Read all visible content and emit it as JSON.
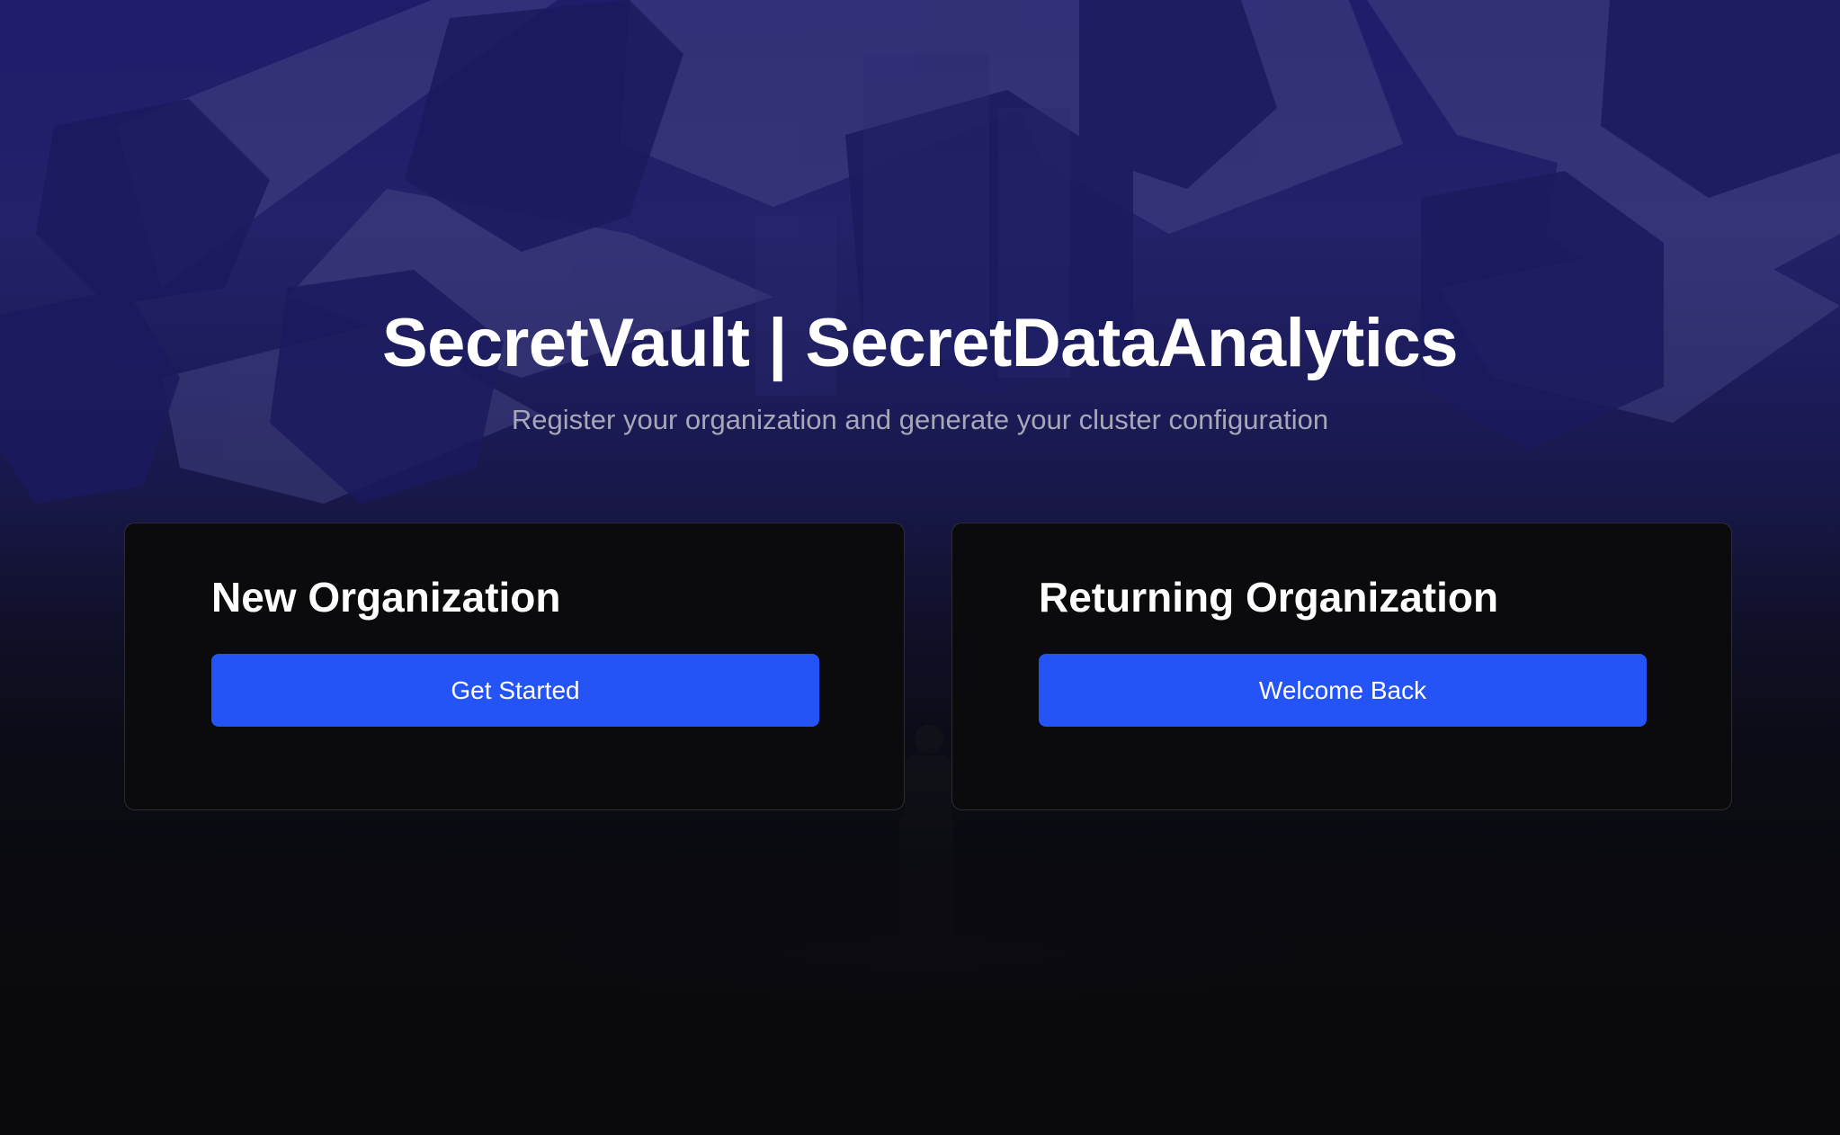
{
  "header": {
    "title": "SecretVault | SecretDataAnalytics",
    "subtitle": "Register your organization and generate your cluster configuration"
  },
  "cards": [
    {
      "title": "New Organization",
      "button_label": "Get Started"
    },
    {
      "title": "Returning Organization",
      "button_label": "Welcome Back"
    }
  ],
  "colors": {
    "accent": "#2454f5",
    "card_background": "#0b0b0d",
    "background_top": "#1e1d6a",
    "background_bottom": "#09090d",
    "subtitle_text": "#a7a7b8"
  }
}
